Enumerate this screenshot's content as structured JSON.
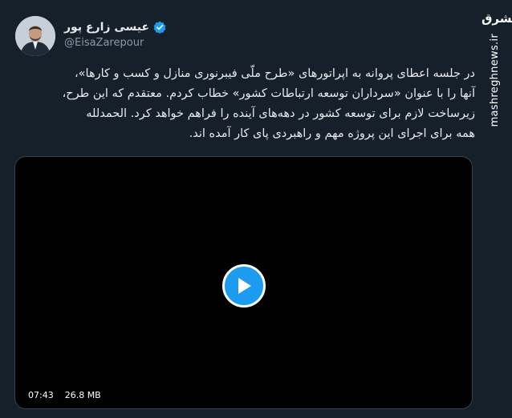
{
  "author": {
    "name": "عیسی زارع پور",
    "handle": "@EisaZarepour",
    "verified": true
  },
  "watermark": {
    "logo_text": "مشرق",
    "url": "mashreghnews.ir"
  },
  "tweet": {
    "lines": [
      "در جلسه اعطای پروانه به اپراتورهای «طرح ملّی فیبرنوری منازل و کسب و کارها»،",
      "آنها را با عنوان «سرداران توسعه ارتباطات کشور» خطاب کردم. معتقدم که این طرح،",
      "زیرساخت لازم برای توسعه کشور در دهه‌های آینده را فراهم خواهد کرد. الحمدلله",
      "همه برای اجرای این پروژه مهم و راهبردی پای کار آمده اند."
    ]
  },
  "video": {
    "duration": "07:43",
    "size": "26.8 MB"
  },
  "colors": {
    "background": "#15202b",
    "accent": "#1d9bf0",
    "text": "#e7e9ea",
    "muted": "#8b98a5"
  }
}
